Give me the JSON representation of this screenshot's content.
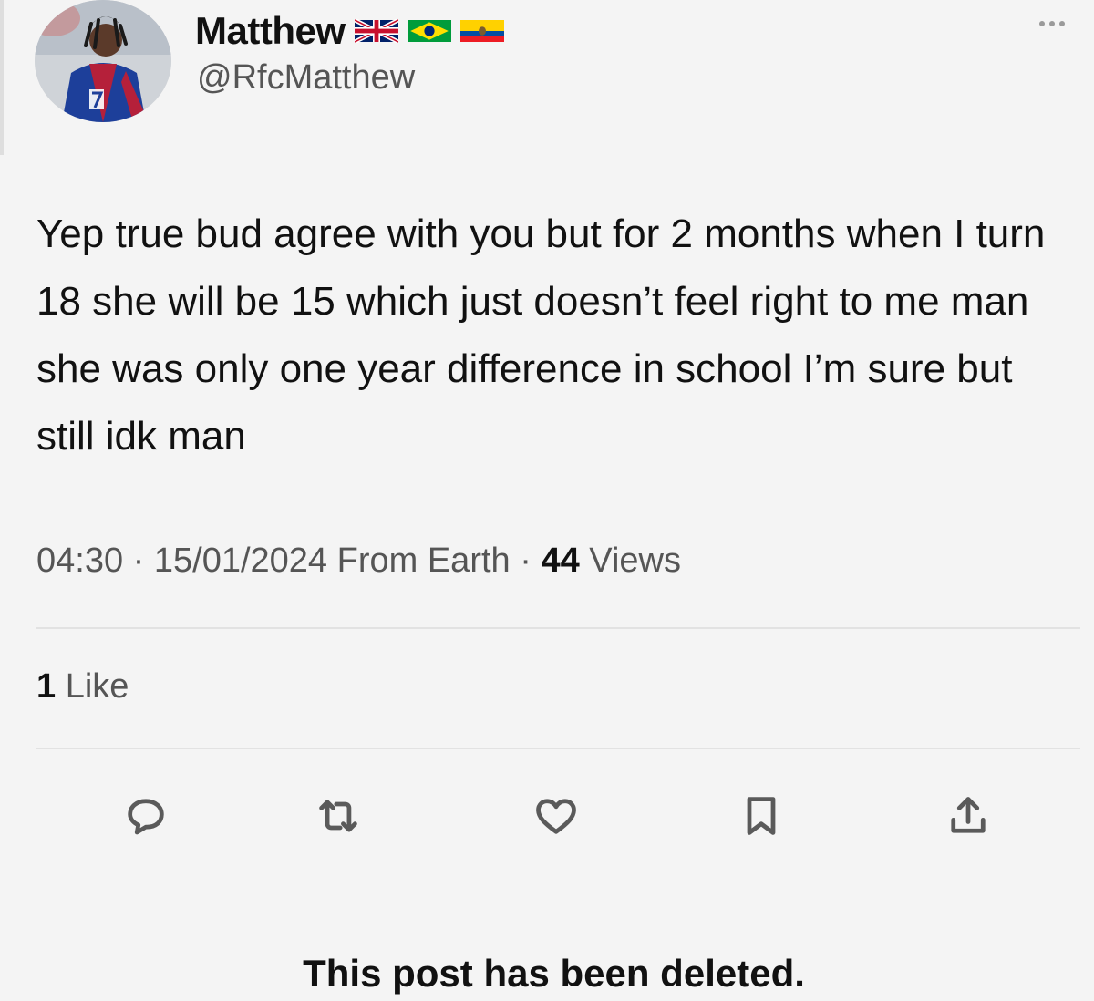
{
  "author": {
    "display_name": "Matthew",
    "handle": "@RfcMatthew",
    "flags": [
      "uk-flag-icon",
      "brazil-flag-icon",
      "ecuador-flag-icon"
    ]
  },
  "tweet": {
    "text": "Yep true bud agree with you but for 2 months when I turn 18 she will be 15 which just doesn’t feel right to me man she was only one year difference in school I’m sure but still idk man",
    "time": "04:30",
    "date": "15/01/2024",
    "source": "From Earth",
    "views_count": "44",
    "views_label": "Views",
    "likes_count": "1",
    "likes_label": "Like"
  },
  "actions": [
    "reply-icon",
    "retweet-icon",
    "like-icon",
    "bookmark-icon",
    "share-icon"
  ],
  "notice": "This post has been deleted.",
  "colors": {
    "background": "#f4f4f4",
    "text": "#111111",
    "muted": "#555555",
    "icon": "#5a5a5a",
    "divider": "#e2e2e2"
  }
}
